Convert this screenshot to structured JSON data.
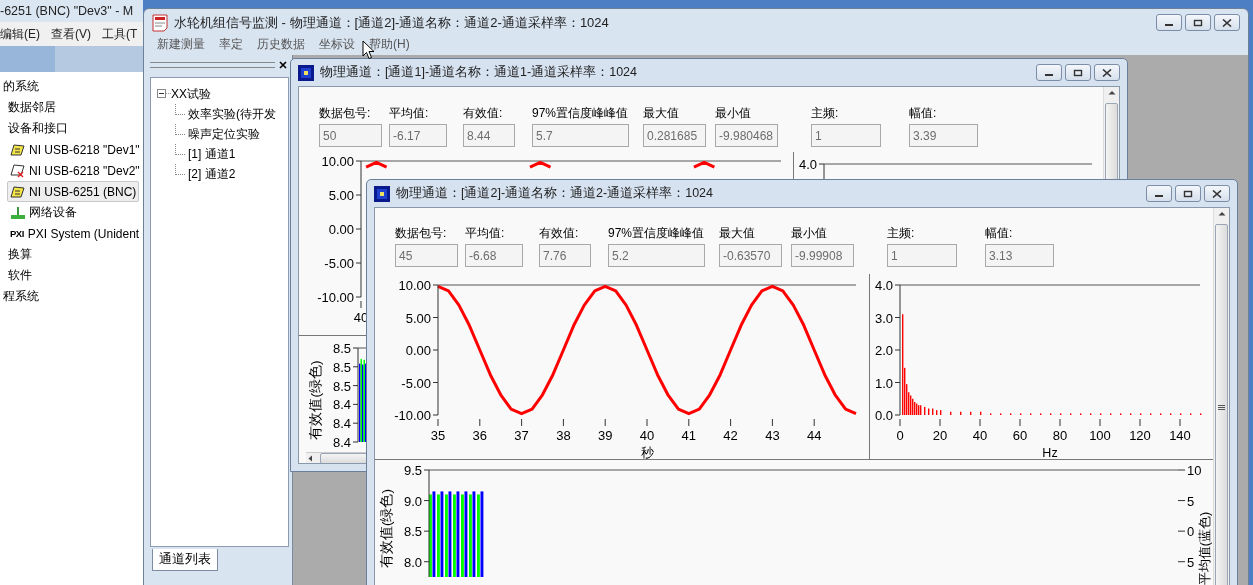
{
  "background_window": {
    "title": "-6251 (BNC) \"Dev3\" - M",
    "menu": [
      "编辑(E)",
      "查看(V)",
      "工具(T"
    ],
    "tree": [
      {
        "label": "的系统",
        "selected": false,
        "children": [
          {
            "label": "数据邻居",
            "selected": false
          },
          {
            "label": "设备和接口",
            "selected": false,
            "children": [
              {
                "label": "NI USB-6218 \"Dev1\"",
                "kind": "device",
                "selected": false
              },
              {
                "label": "NI USB-6218 \"Dev2\"",
                "kind": "device_error",
                "selected": false
              },
              {
                "label": "NI USB-6251 (BNC)",
                "kind": "device",
                "selected": true
              },
              {
                "label": "网络设备",
                "kind": "network",
                "selected": false
              },
              {
                "label": "PXI System (Unident",
                "kind": "pxi",
                "badge": "PXI",
                "selected": false
              }
            ]
          },
          {
            "label": "换算",
            "selected": false
          },
          {
            "label": "软件",
            "selected": false
          }
        ]
      },
      {
        "label": "程系统",
        "selected": false
      }
    ]
  },
  "main_window": {
    "title": "水轮机组信号监测 - 物理通道：[通道2]-通道名称：通道2-通道采样率：1024",
    "menu": [
      "新建测量",
      "率定",
      "历史数据",
      "坐标设",
      "帮助(H)"
    ],
    "sidebar": {
      "tree": [
        {
          "label": "XX试验",
          "expanded": true,
          "children": [
            {
              "label": "效率实验(待开发"
            },
            {
              "label": "噪声定位实验"
            },
            {
              "label": "[1] 通道1"
            },
            {
              "label": "[2] 通道2"
            }
          ]
        }
      ],
      "tabs": [
        {
          "label": "通道列表",
          "selected": true
        }
      ]
    }
  },
  "child_windows": [
    {
      "title": "物理通道：[通道1]-通道名称：通道1-通道采样率：1024",
      "stats": [
        {
          "label": "数据包号:",
          "value": "50"
        },
        {
          "label": "平均值:",
          "value": "-6.17"
        },
        {
          "label": "有效值:",
          "value": "8.44"
        },
        {
          "label": "97%置信度峰峰值",
          "value": "5.7"
        },
        {
          "label": "最大值",
          "value": "0.281685"
        },
        {
          "label": "最小值",
          "value": "-9.980468"
        },
        {
          "label": "主频:",
          "value": "1"
        },
        {
          "label": "幅值:",
          "value": "3.39"
        }
      ],
      "time_chart": {
        "chart_data": {
          "type": "line",
          "ylim": [
            -10,
            10
          ],
          "yticks": [
            {
              "value": 10,
              "label": "10.00"
            },
            {
              "value": 5,
              "label": "5.00"
            },
            {
              "value": 0,
              "label": "0.00"
            },
            {
              "value": -5,
              "label": "-5.00"
            },
            {
              "value": -10,
              "label": "-10.00"
            }
          ],
          "categories": [
            null,
            null,
            null,
            null,
            null,
            null,
            null,
            null,
            null,
            null,
            null,
            null,
            null,
            null,
            null,
            null,
            null,
            null,
            null,
            null,
            null,
            null,
            null,
            null,
            null,
            null,
            null,
            null,
            null,
            null,
            null,
            null,
            null,
            null,
            null,
            null,
            null,
            null,
            null,
            null,
            null
          ],
          "annotations": [
            "40"
          ],
          "series": [
            {
              "color": "#ff0000",
              "values": [
                9.1,
                9.8,
                9.1,
                null,
                null,
                null,
                null,
                null,
                null,
                null,
                null,
                null,
                null,
                null,
                null,
                null,
                9.1,
                9.8,
                9.1,
                null,
                null,
                null,
                null,
                null,
                null,
                null,
                null,
                null,
                null,
                null,
                null,
                null,
                9.1,
                9.8,
                9.1,
                null,
                null,
                null,
                null,
                null,
                null
              ]
            }
          ]
        }
      },
      "spectrum_chart": {
        "tick_label": "4.0"
      },
      "trend_chart": {
        "ylabel": "有效值(绿色)",
        "tick_labels": [
          "8.5",
          "8.5",
          "8.5",
          "8.4",
          "8.4",
          "8.4"
        ]
      }
    },
    {
      "title": "物理通道：[通道2]-通道名称：通道2-通道采样率：1024",
      "stats": [
        {
          "label": "数据包号:",
          "value": "45"
        },
        {
          "label": "平均值:",
          "value": "-6.68"
        },
        {
          "label": "有效值:",
          "value": "7.76"
        },
        {
          "label": "97%置信度峰峰值",
          "value": "5.2"
        },
        {
          "label": "最大值",
          "value": "-0.63570"
        },
        {
          "label": "最小值",
          "value": "-9.99908"
        },
        {
          "label": "主频:",
          "value": "1"
        },
        {
          "label": "幅值:",
          "value": "3.13"
        }
      ],
      "time_chart": {
        "chart_data": {
          "type": "line",
          "xlabel": "秒",
          "xlim": [
            35,
            45
          ],
          "ylim": [
            -10,
            10
          ],
          "xticks": [
            35,
            36,
            37,
            38,
            39,
            40,
            41,
            42,
            43,
            44
          ],
          "yticks": [
            {
              "value": 10,
              "label": "10.00"
            },
            {
              "value": 5,
              "label": "5.00"
            },
            {
              "value": 0,
              "label": "0.00"
            },
            {
              "value": -5,
              "label": "-5.00"
            },
            {
              "value": -10,
              "label": "-10.00"
            }
          ],
          "x": [
            35,
            35.25,
            35.5,
            35.75,
            36,
            36.25,
            36.5,
            36.75,
            37,
            37.25,
            37.5,
            37.75,
            38,
            38.25,
            38.5,
            38.75,
            39,
            39.25,
            39.5,
            39.75,
            40,
            40.25,
            40.5,
            40.75,
            41,
            41.25,
            41.5,
            41.75,
            42,
            42.25,
            42.5,
            42.75,
            43,
            43.25,
            43.5,
            43.75,
            44,
            44.25,
            44.5,
            44.75,
            45
          ],
          "series": [
            {
              "color": "#ff0000",
              "values": [
                9.8,
                9.1,
                6.9,
                3.8,
                0,
                -3.8,
                -6.9,
                -9.1,
                -9.8,
                -9.1,
                -6.9,
                -3.8,
                0,
                3.8,
                6.9,
                9.1,
                9.8,
                9.1,
                6.9,
                3.8,
                0,
                -3.8,
                -6.9,
                -9.1,
                -9.8,
                -9.1,
                -6.9,
                -3.8,
                0,
                3.8,
                6.9,
                9.1,
                9.8,
                9.1,
                6.9,
                3.8,
                0,
                -3.8,
                -6.9,
                -9.1,
                -9.8
              ]
            }
          ]
        }
      },
      "spectrum_chart": {
        "chart_data": {
          "type": "bar",
          "xlabel": "Hz",
          "xlim": [
            0,
            150
          ],
          "ylim": [
            0,
            4
          ],
          "xticks": [
            0,
            20,
            40,
            60,
            80,
            100,
            120,
            140
          ],
          "yticks": [
            {
              "value": 0,
              "label": "0.0"
            },
            {
              "value": 1,
              "label": "1.0"
            },
            {
              "value": 2,
              "label": "2.0"
            },
            {
              "value": 3,
              "label": "3.0"
            },
            {
              "value": 4,
              "label": "4.0"
            }
          ],
          "x": [
            1,
            2,
            3,
            4,
            5,
            6,
            7,
            8,
            9,
            10,
            12,
            14,
            16,
            18,
            20,
            25,
            30,
            35,
            40,
            45,
            50,
            55,
            60,
            65,
            70,
            75,
            80,
            85,
            90,
            95,
            100,
            105,
            110,
            115,
            120,
            125,
            130,
            135,
            140,
            145,
            150
          ],
          "series": [
            {
              "color": "#ff0000",
              "values": [
                3.1,
                1.45,
                0.95,
                0.7,
                0.6,
                0.5,
                0.4,
                0.35,
                0.3,
                0.3,
                0.25,
                0.2,
                0.2,
                0.15,
                0.15,
                0.1,
                0.1,
                0.1,
                0.1,
                0.05,
                0.05,
                0.05,
                0.05,
                0.05,
                0.05,
                0.05,
                0.05,
                0.05,
                0.05,
                0.05,
                0.05,
                0.05,
                0.05,
                0.05,
                0.05,
                0.05,
                0.05,
                0.05,
                0.05,
                0.05,
                0.05
              ]
            }
          ]
        }
      },
      "trend_chart": {
        "chart_data": {
          "type": "bar",
          "ylabel": "有效值(绿色)",
          "ylim": [
            7.75,
            9.5
          ],
          "yticks": [
            {
              "value": 9.5,
              "label": "9.5"
            },
            {
              "value": 9,
              "label": "9.0"
            },
            {
              "value": 8.5,
              "label": "8.5"
            },
            {
              "value": 8,
              "label": "8.0"
            }
          ],
          "categories": [
            null,
            null,
            null,
            null,
            null,
            null,
            null
          ],
          "series": [
            {
              "color": "#00ff00",
              "values": [
                9.1,
                9.1,
                9.1,
                9.1,
                9.1,
                9.1,
                9.1
              ]
            },
            {
              "color": "#0000ff",
              "values": [
                9.15,
                9.15,
                9.15,
                9.15,
                9.15,
                9.15,
                9.15
              ]
            }
          ]
        },
        "right_axis": {
          "label": "平均值(蓝色)",
          "ticks": [
            "10",
            "5",
            "0",
            "5"
          ]
        }
      }
    }
  ]
}
